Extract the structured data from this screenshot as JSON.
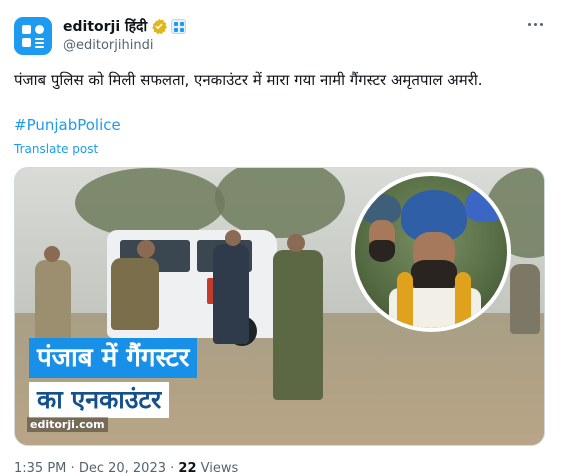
{
  "author": {
    "display_name": "editorji हिंदी",
    "handle": "@editorjihindi",
    "verified_color": "#e2b719",
    "avatar_color": "#1d9bf0"
  },
  "post": {
    "text": "पंजाब पुलिस को मिली सफलता, एनकाउंटर में मारा गया नामी गैंगस्टर अमृतपाल अमरी.",
    "hashtag": "#PunjabPolice",
    "translate_label": "Translate post"
  },
  "media": {
    "headline_line1": "पंजाब में गैंगस्टर",
    "headline_line2": "का एनकाउंटर",
    "watermark": "editorji.com",
    "banner_color": "#1890e8"
  },
  "meta": {
    "time": "1:35 PM",
    "separator": "·",
    "date": "Dec 20, 2023",
    "views_count": "22",
    "views_label": "Views"
  },
  "icons": {
    "more": "more-horizontal-icon",
    "verified": "verified-badge-icon",
    "affiliate": "affiliate-badge-icon"
  }
}
